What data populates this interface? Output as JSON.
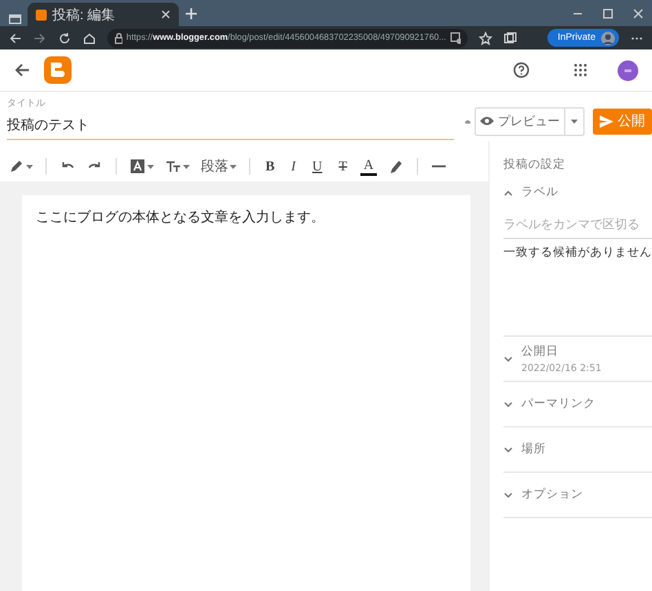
{
  "browser": {
    "tab_title": "投稿: 編集",
    "url_scheme": "https://",
    "url_host": "www.blogger.com",
    "url_path": "/blog/post/edit/4456004683702235008/497090921760...",
    "inprivate": "InPrivate"
  },
  "post": {
    "title_label": "タイトル",
    "title_value": "投稿のテスト",
    "preview": "プレビュー",
    "publish": "公開"
  },
  "toolbar": {
    "paragraph_style": "段落",
    "format_buttons": [
      "B",
      "I",
      "U",
      "T",
      "A"
    ]
  },
  "body_text": "ここにブログの本体となる文章を入力します。",
  "settings": {
    "heading": "投稿の設定",
    "sections": [
      {
        "title": "ラベル",
        "expanded": true,
        "placeholder": "ラベルをカンマで区切る",
        "note": "一致する候補がありません"
      },
      {
        "title": "公開日",
        "expanded": false,
        "subtitle": "2022/02/16 2:51"
      },
      {
        "title": "パーマリンク",
        "expanded": false
      },
      {
        "title": "場所",
        "expanded": false
      },
      {
        "title": "オプション",
        "expanded": false
      }
    ]
  }
}
